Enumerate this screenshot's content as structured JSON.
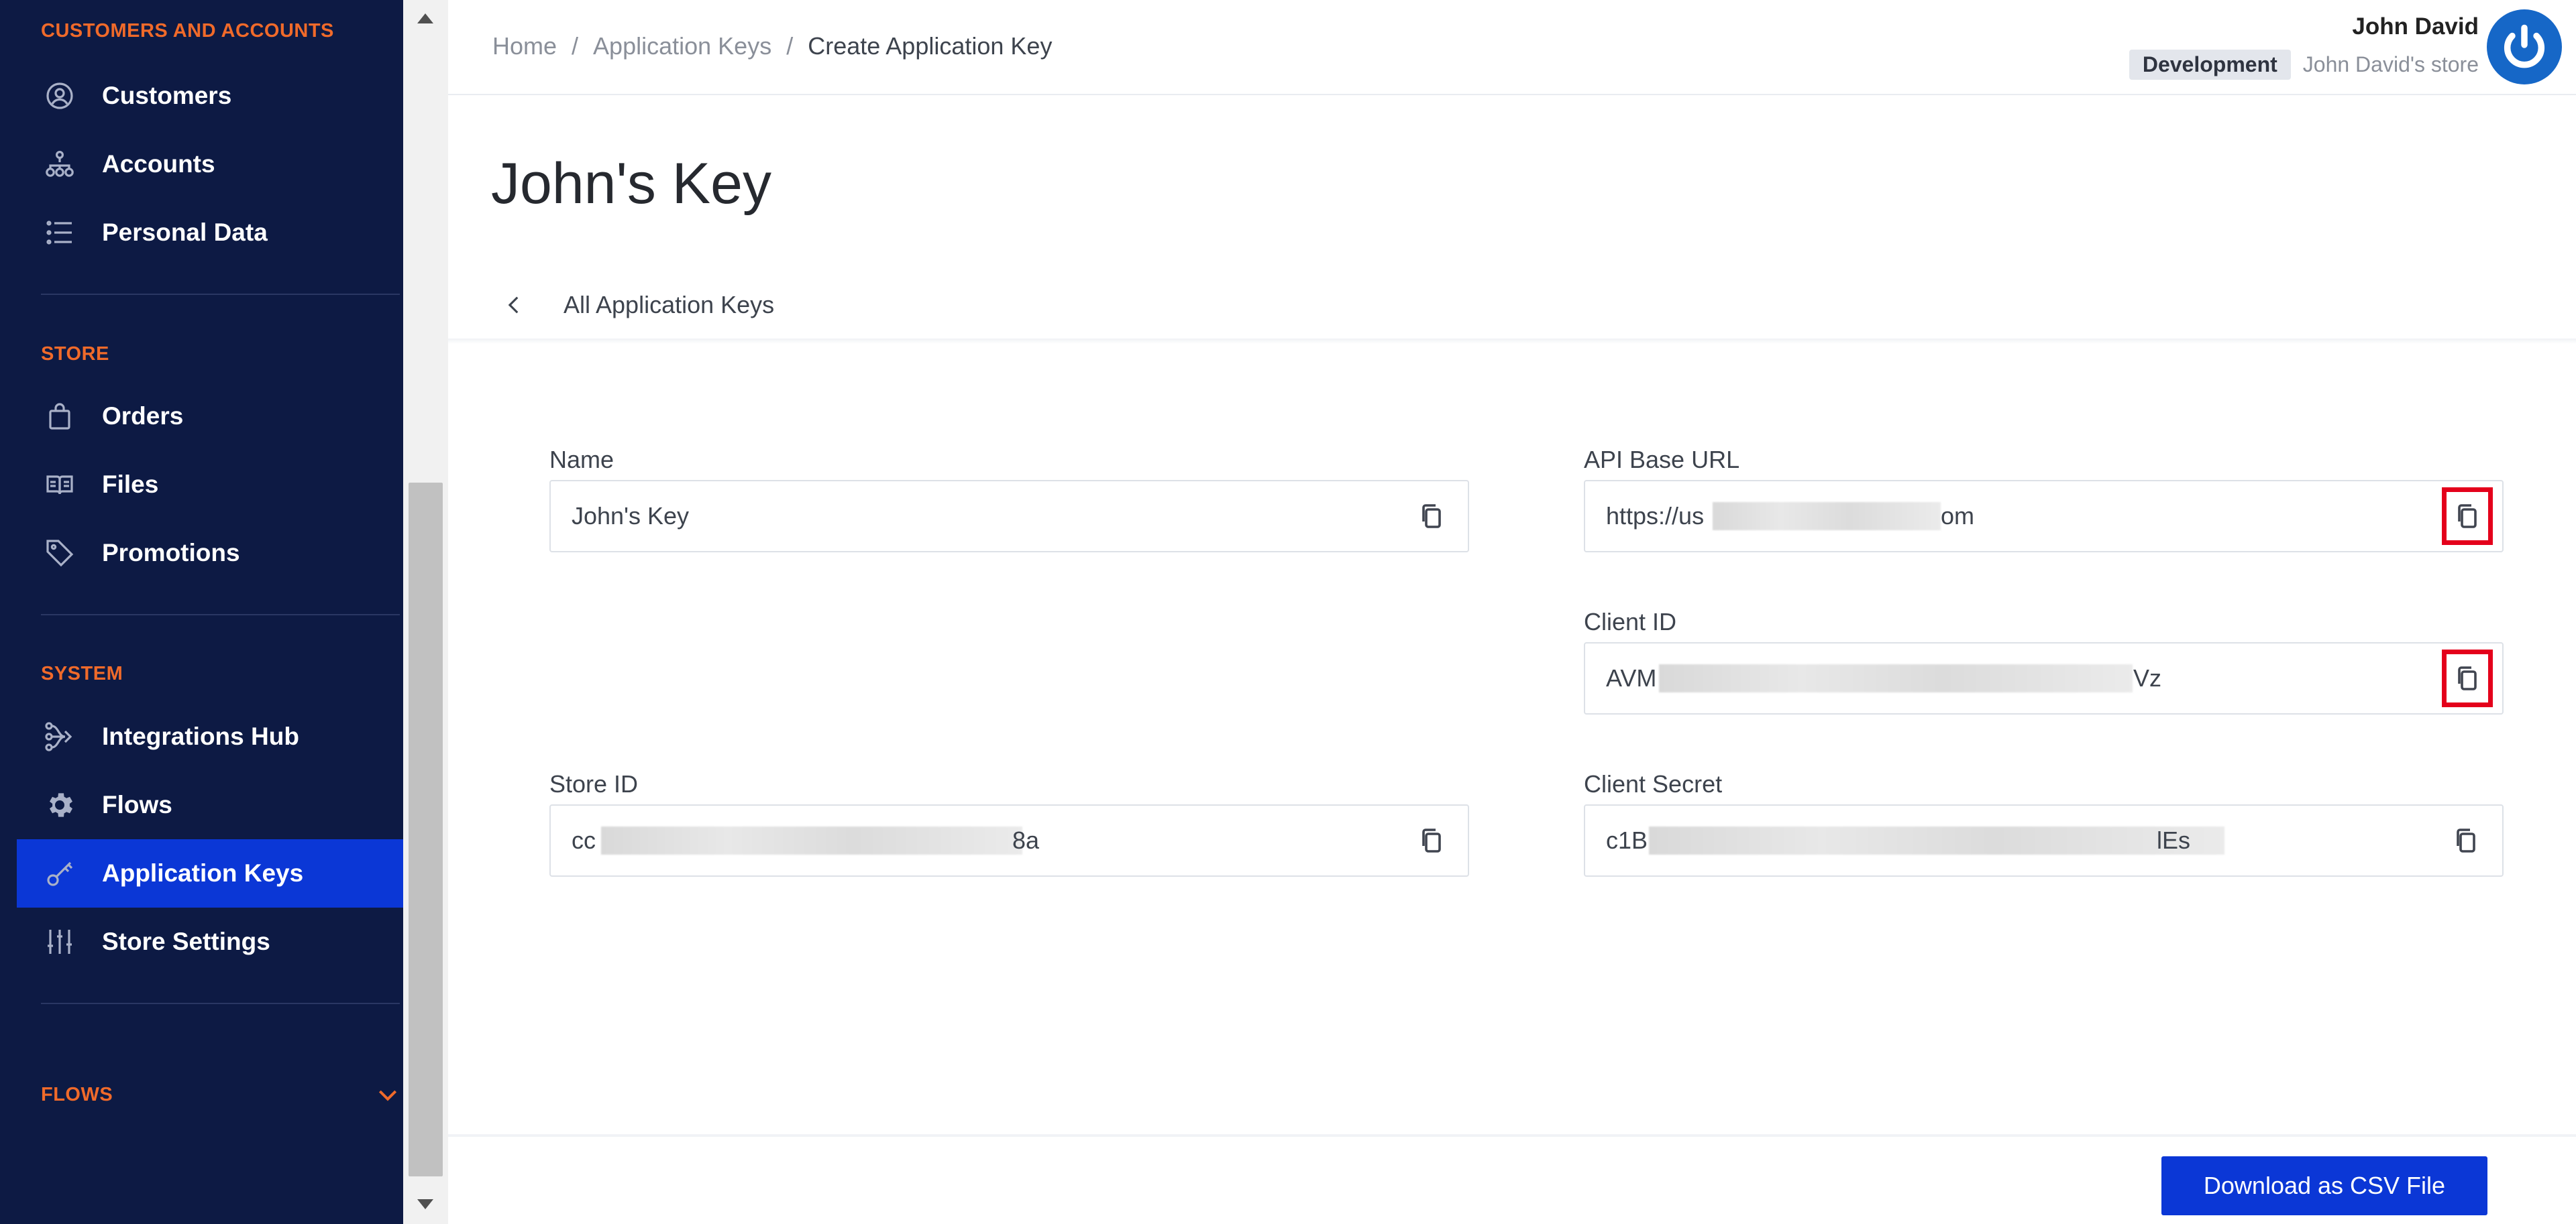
{
  "sidebar": {
    "sections": {
      "customers": "CUSTOMERS AND ACCOUNTS",
      "store": "STORE",
      "system": "SYSTEM",
      "flows": "FLOWS"
    },
    "items": {
      "customers": "Customers",
      "accounts": "Accounts",
      "personal_data": "Personal Data",
      "orders": "Orders",
      "files": "Files",
      "promotions": "Promotions",
      "integrations_hub": "Integrations Hub",
      "flows": "Flows",
      "application_keys": "Application Keys",
      "store_settings": "Store Settings"
    },
    "active_item": "application_keys"
  },
  "breadcrumb": {
    "home": "Home",
    "application_keys": "Application Keys",
    "current": "Create Application Key",
    "separator": "/"
  },
  "user": {
    "name": "John David",
    "environment": "Development",
    "store": "John David's store"
  },
  "page": {
    "title": "John's Key",
    "back_label": "All Application Keys"
  },
  "form": {
    "name": {
      "label": "Name",
      "value": "John's Key"
    },
    "store_id": {
      "label": "Store ID",
      "value_start": "cc",
      "value_end": "8a"
    },
    "api_base_url": {
      "label": "API Base URL",
      "value_start": "https://us",
      "value_end": "om"
    },
    "client_id": {
      "label": "Client ID",
      "value_start": "AVM",
      "value_end": "Vz"
    },
    "client_secret": {
      "label": "Client Secret",
      "value_start": "c1B",
      "value_end": "lEs"
    }
  },
  "footer": {
    "download_label": "Download as CSV File"
  },
  "colors": {
    "sidebar_bg": "#0d1a44",
    "section_heading": "#f06a2a",
    "active_item_bg": "#0b37d6",
    "primary_button": "#0b37d6",
    "highlight_box": "#e4001b",
    "avatar": "#1667c7"
  },
  "icons": {
    "customers": "user-circle-icon",
    "accounts": "account-tree-icon",
    "personal_data": "list-icon",
    "orders": "shopping-bag-icon",
    "files": "book-icon",
    "promotions": "tag-icon",
    "integrations_hub": "hub-icon",
    "flows": "gear-icon",
    "application_keys": "key-icon",
    "store_settings": "sliders-icon",
    "copy": "copy-icon",
    "back": "chevron-left-icon",
    "avatar": "power-icon"
  }
}
